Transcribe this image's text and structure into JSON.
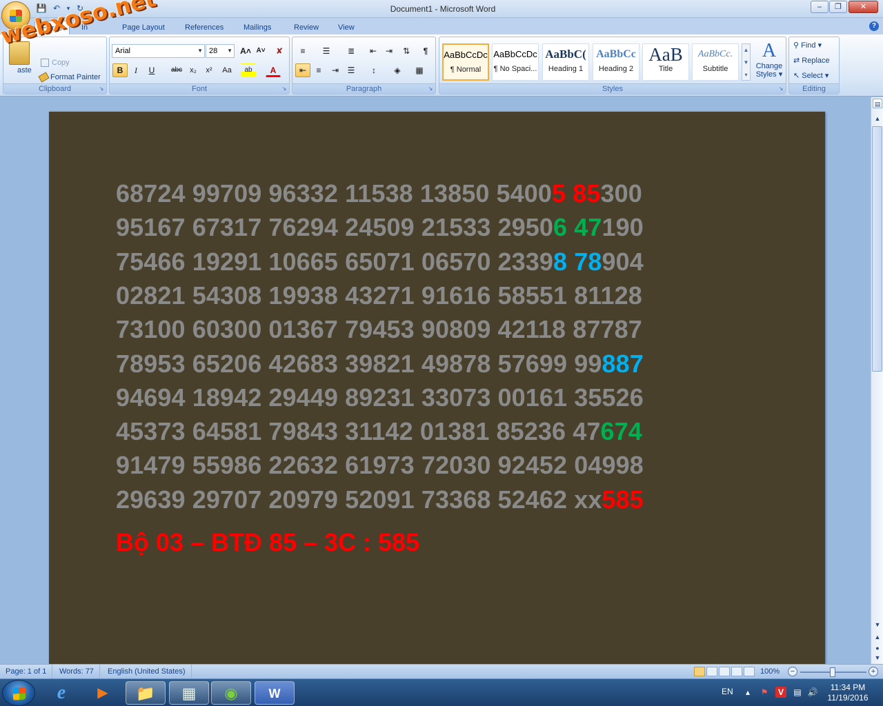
{
  "window": {
    "title": "Document1 - Microsoft Word",
    "minimize_glyph": "–",
    "maximize_glyph": "❐",
    "close_glyph": "✕"
  },
  "quick_access": {
    "save_icon": "💾",
    "undo_icon": "↶",
    "redo_icon": "↻",
    "customize_icon": "▾"
  },
  "tabs": [
    "Home",
    "Insert",
    "Page Layout",
    "References",
    "Mailings",
    "Review",
    "View"
  ],
  "tabs_visible": {
    "home": "Home",
    "insert": "In",
    "page_layout": "Page Layout",
    "references": "References",
    "mailings": "Mailings",
    "review": "Review",
    "view": "View"
  },
  "help_glyph": "?",
  "clipboard": {
    "paste_label": "aste",
    "copy_label": "Copy",
    "format_painter_label": "Format Painter",
    "group_label": "Clipboard"
  },
  "font": {
    "name_value": "Arial",
    "size_value": "28",
    "group_label": "Font",
    "grow_glyph": "A˄",
    "shrink_glyph": "A˅",
    "clear_glyph": "✘",
    "bold_glyph": "B",
    "italic_glyph": "I",
    "underline_glyph": "U",
    "strike_glyph": "abc",
    "subscript_glyph": "x₂",
    "superscript_glyph": "x²",
    "case_glyph": "Aa",
    "highlight_glyph": "ab",
    "color_glyph": "A"
  },
  "paragraph": {
    "group_label": "Paragraph",
    "pilcrow_glyph": "¶"
  },
  "styles": {
    "group_label": "Styles",
    "items": [
      {
        "sample": "AaBbCcDc",
        "name": "¶ Normal"
      },
      {
        "sample": "AaBbCcDc",
        "name": "¶ No Spaci..."
      },
      {
        "sample": "AaBbC(",
        "name": "Heading 1"
      },
      {
        "sample": "AaBbCc",
        "name": "Heading 2"
      },
      {
        "sample": "AaB",
        "name": "Title"
      },
      {
        "sample": "AaBbCc.",
        "name": "Subtitle"
      }
    ],
    "change_styles_line1": "Change",
    "change_styles_line2": "Styles ▾"
  },
  "editing": {
    "find_label": "Find ▾",
    "replace_label": "Replace",
    "select_label": "Select ▾",
    "group_label": "Editing"
  },
  "watermark": "webxoso.net",
  "document": {
    "lines": [
      [
        {
          "t": "68724 99709 96332 11538 13850 5400",
          "c": "gray"
        },
        {
          "t": "5 85",
          "c": "red"
        },
        {
          "t": "300",
          "c": "gray"
        }
      ],
      [
        {
          "t": "95167 67317 76294 24509 21533 2950",
          "c": "gray"
        },
        {
          "t": "6 47",
          "c": "green"
        },
        {
          "t": "190",
          "c": "gray"
        }
      ],
      [
        {
          "t": "75466 19291 10665 65071 06570 2339",
          "c": "gray"
        },
        {
          "t": "8 78",
          "c": "blue"
        },
        {
          "t": "904",
          "c": "gray"
        }
      ],
      [
        {
          "t": "02821 54308 19938 43271 91616 58551 81128",
          "c": "gray"
        }
      ],
      [
        {
          "t": "73100 60300 01367 79453 90809 42118 87787",
          "c": "gray"
        }
      ],
      [
        {
          "t": "78953 65206 42683 39821 49878 57699 99",
          "c": "gray"
        },
        {
          "t": "887",
          "c": "blue"
        }
      ],
      [
        {
          "t": "94694 18942 29449 89231 33073 00161 35526",
          "c": "gray"
        }
      ],
      [
        {
          "t": "45373 64581 79843 31142 01381 85236 47",
          "c": "gray"
        },
        {
          "t": "674",
          "c": "green"
        }
      ],
      [
        {
          "t": "91479 55986 22632 61973 72030 92452 04998",
          "c": "gray"
        }
      ],
      [
        {
          "t": "29639 29707 20979 52091 73368 52462 xx",
          "c": "gray"
        },
        {
          "t": "585",
          "c": "red"
        }
      ]
    ],
    "summary": "Bộ 03 – BTĐ 85 – 3C : 585"
  },
  "status": {
    "page": "Page: 1 of 1",
    "words": "Words: 77",
    "language": "English (United States)",
    "zoom": "100%",
    "zoom_minus": "−",
    "zoom_plus": "+"
  },
  "taskbar": {
    "lang": "EN",
    "time": "11:34 PM",
    "date": "11/19/2016",
    "tray_up_glyph": "▴"
  },
  "colors": {
    "page_bg": "#48402b",
    "digits_gray": "#8a8a8a",
    "red": "#ff0000",
    "green": "#00b050",
    "blue": "#00b0f0"
  }
}
